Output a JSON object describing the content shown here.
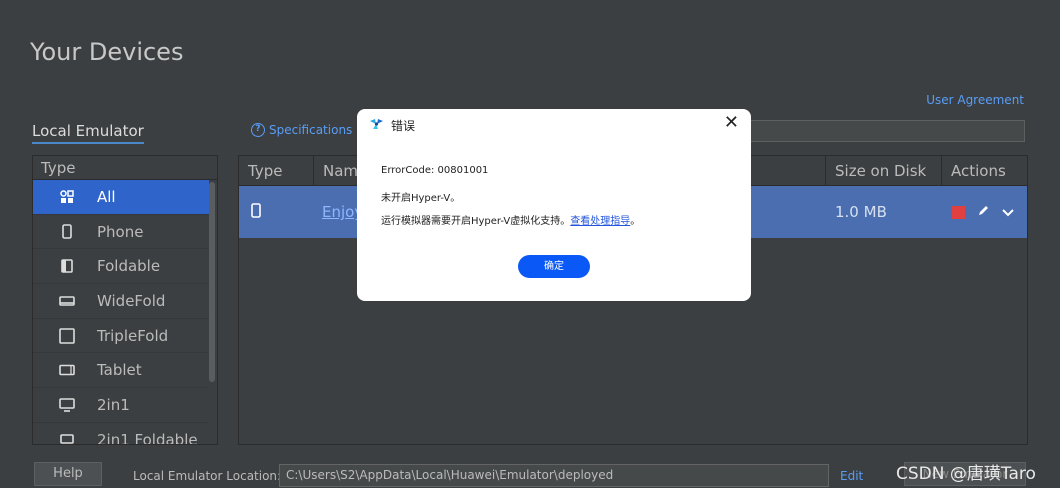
{
  "page": {
    "title": "Your Devices",
    "user_agreement": "User Agreement"
  },
  "tabs": {
    "local_emulator": "Local Emulator",
    "specifications": "Specifications"
  },
  "sidebar": {
    "header": "Type",
    "items": [
      {
        "label": "All",
        "icon": "grid-icon"
      },
      {
        "label": "Phone",
        "icon": "phone-icon"
      },
      {
        "label": "Foldable",
        "icon": "foldable-icon"
      },
      {
        "label": "WideFold",
        "icon": "widefold-icon"
      },
      {
        "label": "TripleFold",
        "icon": "triplefold-icon"
      },
      {
        "label": "Tablet",
        "icon": "tablet-icon"
      },
      {
        "label": "2in1",
        "icon": "monitor-icon"
      },
      {
        "label": "2in1 Foldable",
        "icon": "laptop-icon"
      }
    ]
  },
  "table": {
    "headers": {
      "type": "Type",
      "name": "Nam",
      "size": "Size on Disk",
      "actions": "Actions"
    },
    "rows": [
      {
        "name": "Enjoy",
        "size": "1.0 MB"
      }
    ]
  },
  "footer": {
    "help": "Help",
    "location_label": "Local Emulator Location:",
    "location_value": "C:\\Users\\S2\\AppData\\Local\\Huawei\\Emulator\\deployed",
    "edit": "Edit",
    "new_emulator": "New Emulator"
  },
  "watermark": "CSDN @唐璜Taro",
  "dialog": {
    "title": "错误",
    "error_code": "ErrorCode: 00801001",
    "line1": "未开启Hyper-V。",
    "line2": "运行模拟器需要开启Hyper-V虚拟化支持。",
    "link": "查看处理指导",
    "link_suffix": "。",
    "ok": "确定"
  },
  "colors": {
    "accent": "#2f65ca",
    "selected_row": "#4a6eb0",
    "stop": "#e04040",
    "dialog_button": "#0a59f7"
  }
}
